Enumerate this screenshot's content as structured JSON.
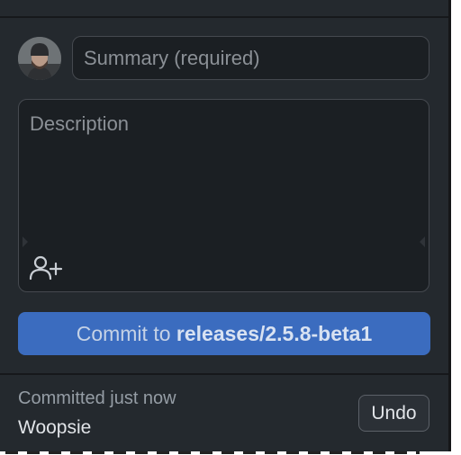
{
  "summary": {
    "placeholder": "Summary (required)",
    "value": ""
  },
  "description": {
    "placeholder": "Description",
    "value": ""
  },
  "icons": {
    "avatar": "user-avatar-photo",
    "coauthor": "person-add-icon"
  },
  "commit_button": {
    "prefix": "Commit to ",
    "branch": "releases/2.5.8-beta1"
  },
  "last_commit": {
    "status": "Committed just now",
    "message": "Woopsie",
    "undo_label": "Undo"
  },
  "colors": {
    "panel_bg": "#24292e",
    "input_bg": "#1b1f23",
    "commit_button_bg": "#3b6cbf"
  }
}
